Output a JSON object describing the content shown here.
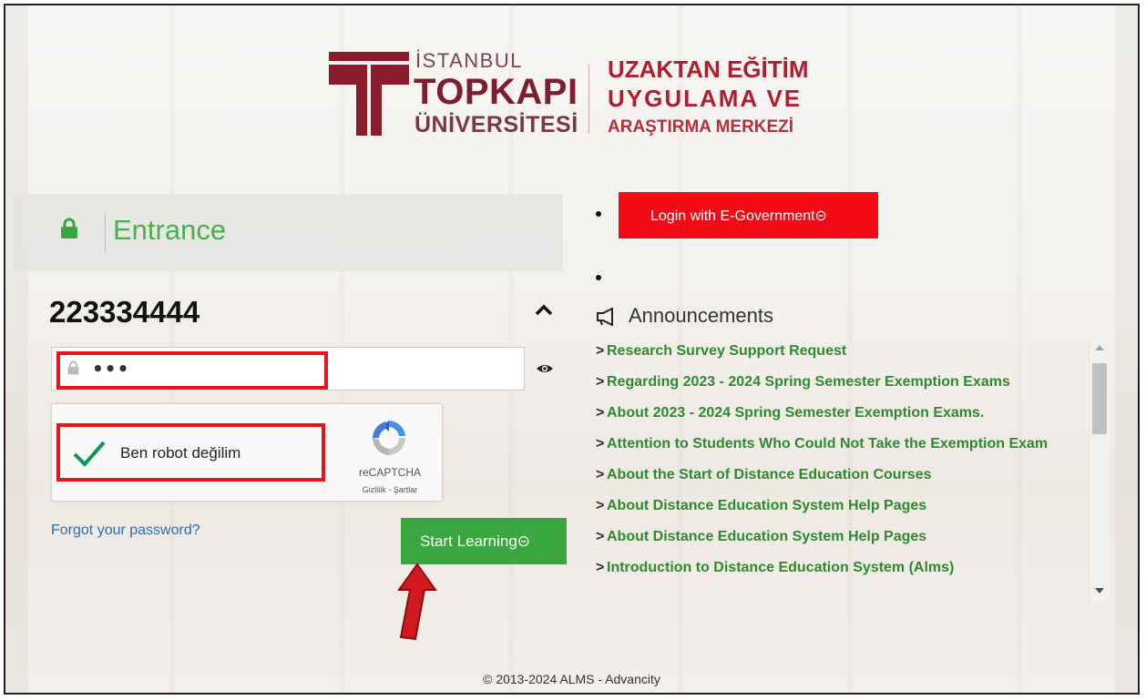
{
  "header": {
    "university_line1": "İSTANBUL",
    "university_line2": "TOPKAPI",
    "university_line3": "ÜNİVERSİTESİ",
    "center_line1": "UZAKTAN EĞİTİM",
    "center_line2": "UYGULAMA VE",
    "center_line3": "ARAŞTIRMA MERKEZİ",
    "brand_color": "#8a1c2b"
  },
  "login": {
    "section_title": "Entrance",
    "username": "223334444",
    "password_masked": "•••",
    "captcha_label": "Ben robot değilim",
    "captcha_brand": "reCAPTCHA",
    "captcha_links": "Gizlilik - Şartlar",
    "forgot_link": "Forgot your password?",
    "start_button": "Start Learning⊝",
    "accent_color": "#3aa640"
  },
  "egov": {
    "button_label": "Login with E-Government⊝",
    "color": "#f20a14"
  },
  "announcements": {
    "title": "Announcements",
    "items": [
      "Research Survey Support Request",
      "Regarding 2023 - 2024 Spring Semester Exemption Exams",
      "About 2023 - 2024 Spring Semester Exemption Exams.",
      "Attention to Students Who Could Not Take the Exemption Exam",
      "About the Start of Distance Education Courses",
      "About Distance Education System Help Pages",
      "About Distance Education System Help Pages",
      "Introduction to Distance Education System (Alms)"
    ]
  },
  "footer": {
    "text": "© 2013-2024 ALMS - Advancity"
  }
}
